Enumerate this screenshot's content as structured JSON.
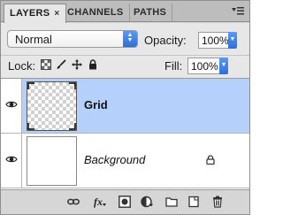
{
  "tabs": [
    {
      "label": "LAYERS"
    },
    {
      "label": "CHANNELS"
    },
    {
      "label": "PATHS"
    }
  ],
  "tab_close": "×",
  "blend_mode": "Normal",
  "opacity": {
    "label": "Opacity:",
    "value": "100%"
  },
  "lock": {
    "label": "Lock:"
  },
  "fill": {
    "label": "Fill:",
    "value": "100%"
  },
  "layers": [
    {
      "name": "Grid",
      "selected": true,
      "thumbnail": "transparent-checker"
    },
    {
      "name": "Background",
      "selected": false,
      "thumbnail": "white",
      "locked": true
    }
  ],
  "toolbar_icons": [
    "link-layers-icon",
    "fx-icon",
    "layer-mask-icon",
    "adjustment-layer-icon",
    "new-group-icon",
    "new-layer-icon",
    "delete-layer-icon"
  ],
  "colors": {
    "selection": "#b5d0fa",
    "accent": "#3b82e8",
    "panel": "#d6d6d6"
  }
}
